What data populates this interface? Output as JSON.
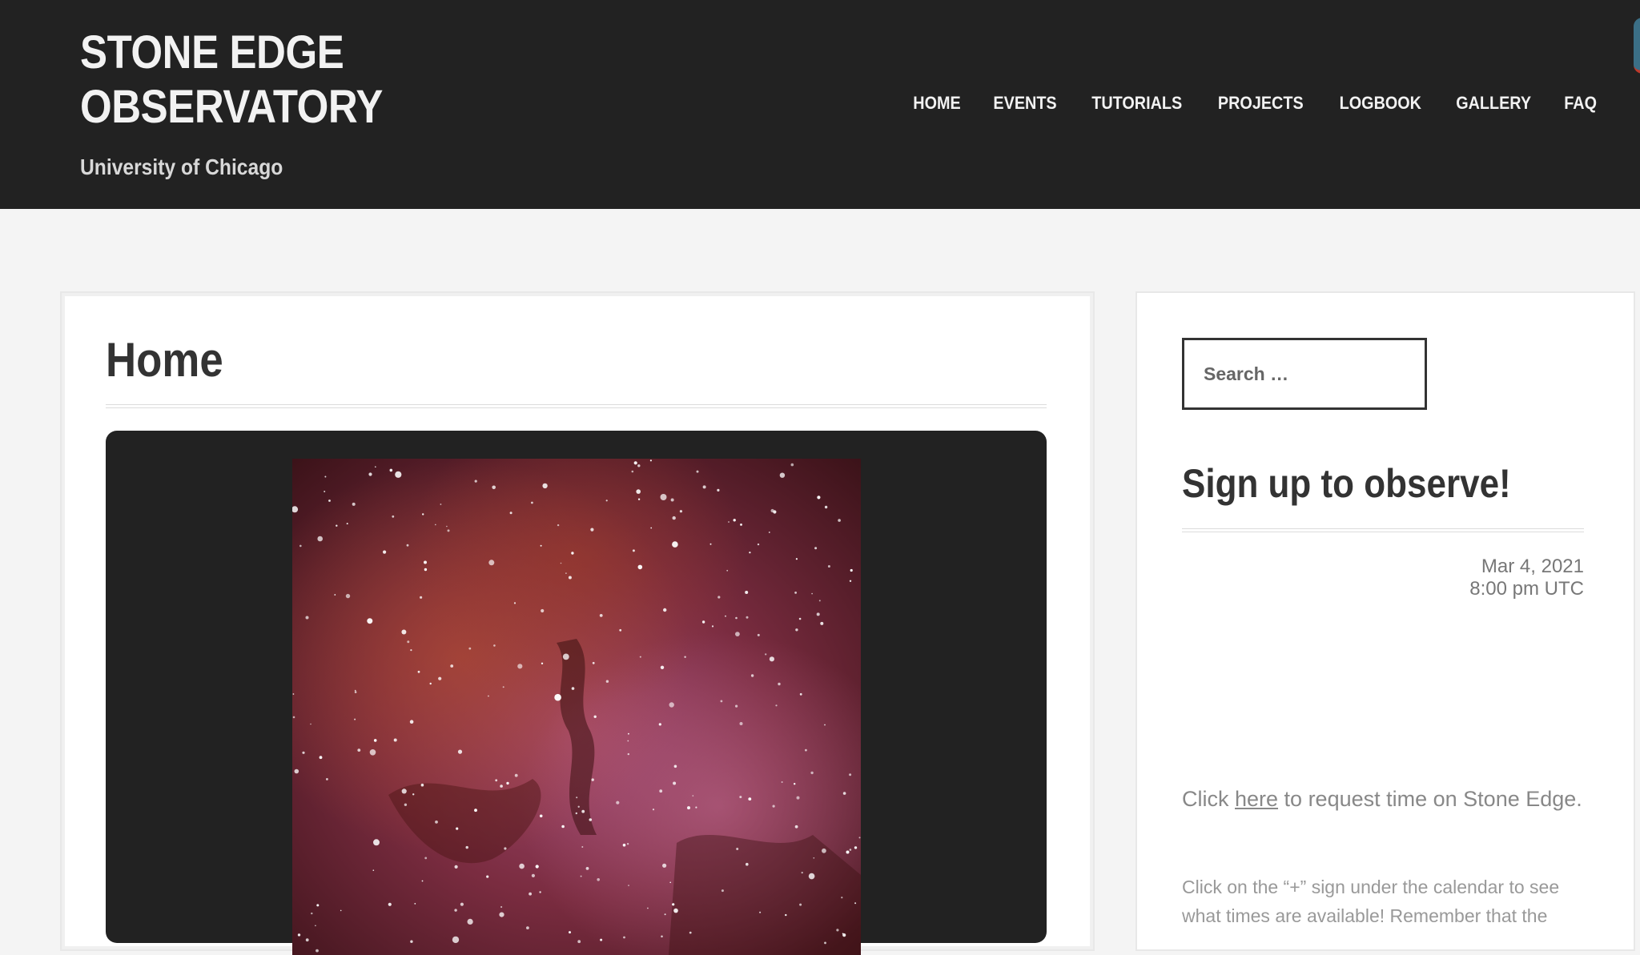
{
  "site": {
    "title_line1": "STONE EDGE",
    "title_line2": "OBSERVATORY",
    "tagline": "University of Chicago"
  },
  "nav": {
    "items": [
      {
        "label": "HOME"
      },
      {
        "label": "EVENTS"
      },
      {
        "label": "TUTORIALS"
      },
      {
        "label": "PROJECTS"
      },
      {
        "label": "LOGBOOK"
      },
      {
        "label": "GALLERY"
      },
      {
        "label": "FAQ"
      }
    ]
  },
  "main": {
    "page_title": "Home"
  },
  "sidebar": {
    "search_placeholder": "Search …",
    "widget_title": "Sign up to observe!",
    "event_date": "Mar 4, 2021",
    "event_time": "8:00 pm UTC",
    "signup_prefix": "Click ",
    "signup_link": "here",
    "signup_suffix": " to request time on Stone Edge.",
    "help_text": "Click on the “+” sign under the calendar to see what times are available! Remember that the"
  },
  "colors": {
    "header_bg": "#222222",
    "page_bg": "#f4f4f4",
    "nebula_red": "#8a2a2a",
    "nebula_purple": "#6a2a5a"
  }
}
